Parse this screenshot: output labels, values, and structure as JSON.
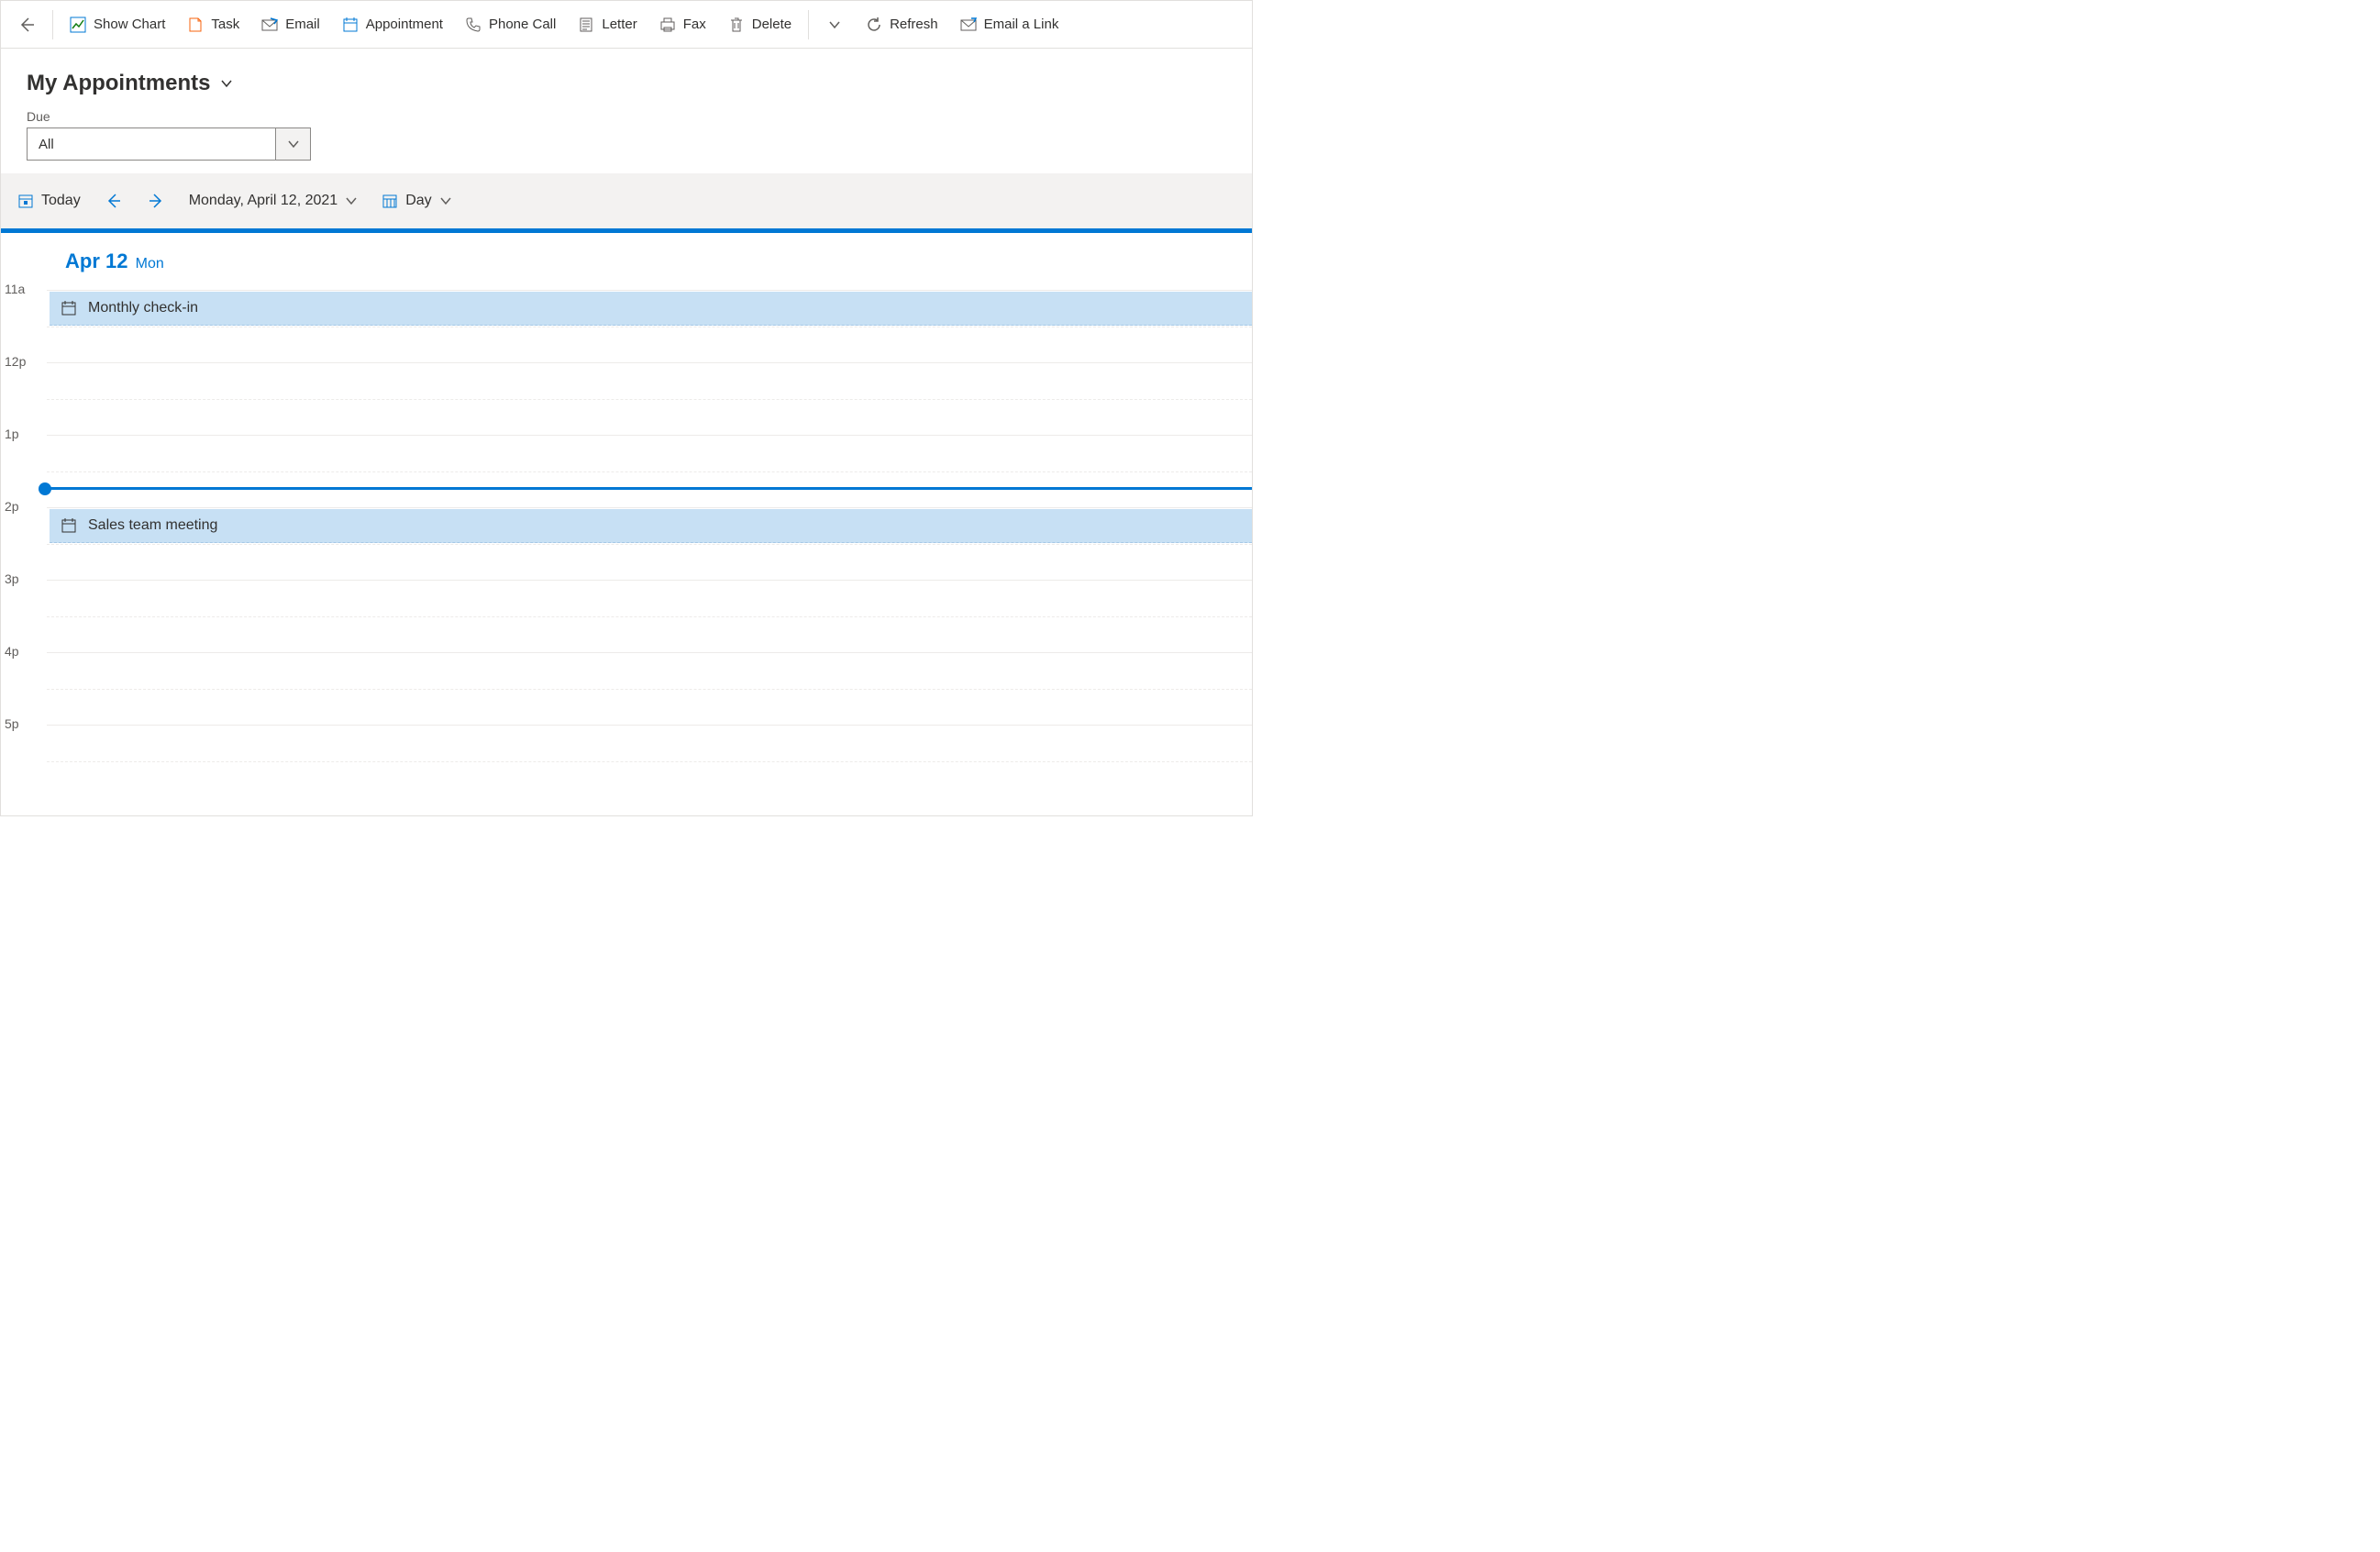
{
  "toolbar": {
    "show_chart": "Show Chart",
    "task": "Task",
    "email": "Email",
    "appointment": "Appointment",
    "phone_call": "Phone Call",
    "letter": "Letter",
    "fax": "Fax",
    "delete": "Delete",
    "refresh": "Refresh",
    "email_link": "Email a Link"
  },
  "page": {
    "title": "My Appointments"
  },
  "filter": {
    "label": "Due",
    "value": "All"
  },
  "cal_toolbar": {
    "today": "Today",
    "date": "Monday, April 12, 2021",
    "view": "Day"
  },
  "day_header": {
    "date": "Apr 12",
    "dow": "Mon"
  },
  "hours": [
    "11a",
    "12p",
    "1p",
    "2p",
    "3p",
    "4p",
    "5p"
  ],
  "appointments": [
    {
      "title": "Monthly check-in",
      "hour_index": 0,
      "half": 0
    },
    {
      "title": "Sales team meeting",
      "hour_index": 3,
      "half": 0
    }
  ],
  "now": {
    "hour_index": 2,
    "fraction": 0.72
  }
}
